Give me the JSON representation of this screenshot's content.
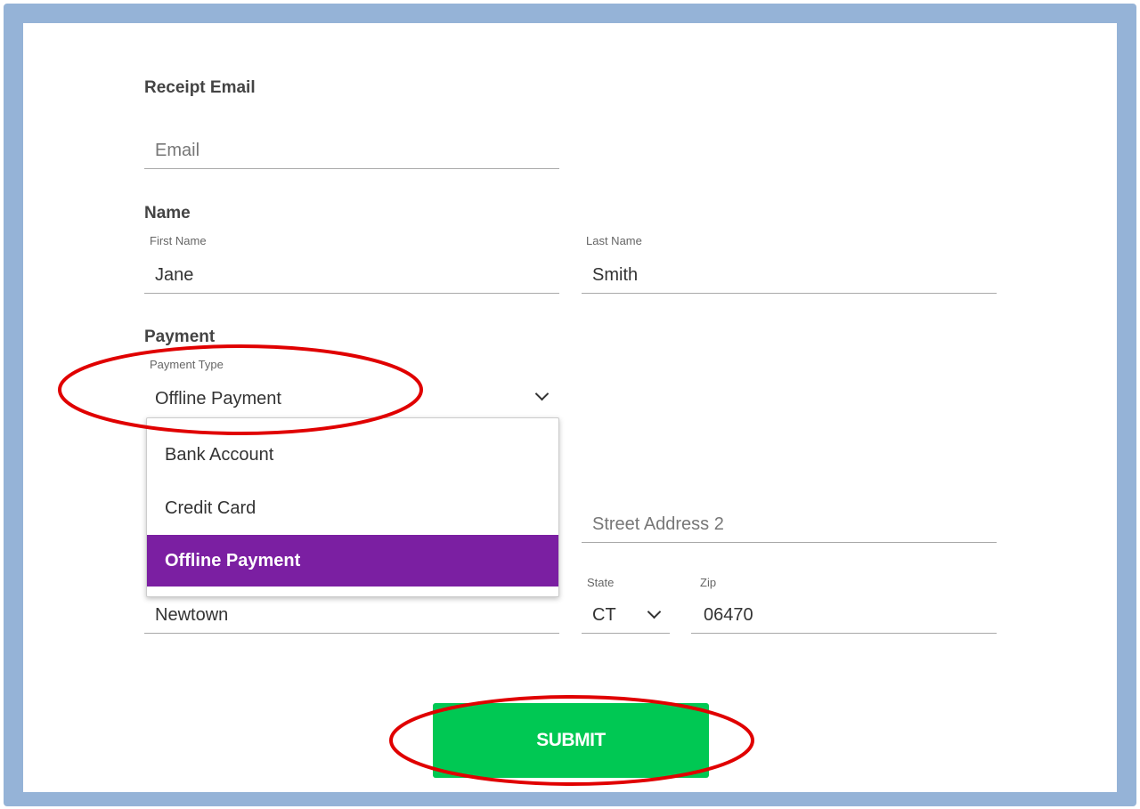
{
  "receipt": {
    "title": "Receipt Email",
    "email_placeholder": "Email"
  },
  "name": {
    "title": "Name",
    "first_label": "First Name",
    "first_value": "Jane",
    "last_label": "Last Name",
    "last_value": "Smith"
  },
  "payment": {
    "title": "Payment",
    "type_label": "Payment Type",
    "type_value": "Offline Payment",
    "options": [
      "Bank Account",
      "Credit Card",
      "Offline Payment"
    ],
    "selected_option": "Offline Payment"
  },
  "address": {
    "street2_placeholder": "Street Address 2",
    "city_value": "Newtown",
    "state_label": "State",
    "state_value": "CT",
    "zip_label": "Zip",
    "zip_value": "06470"
  },
  "submit_label": "SUBMIT",
  "colors": {
    "frame": "#95b3d7",
    "selected_option_bg": "#7b1fa2",
    "submit_bg": "#00c853",
    "annotation": "#e00000"
  }
}
